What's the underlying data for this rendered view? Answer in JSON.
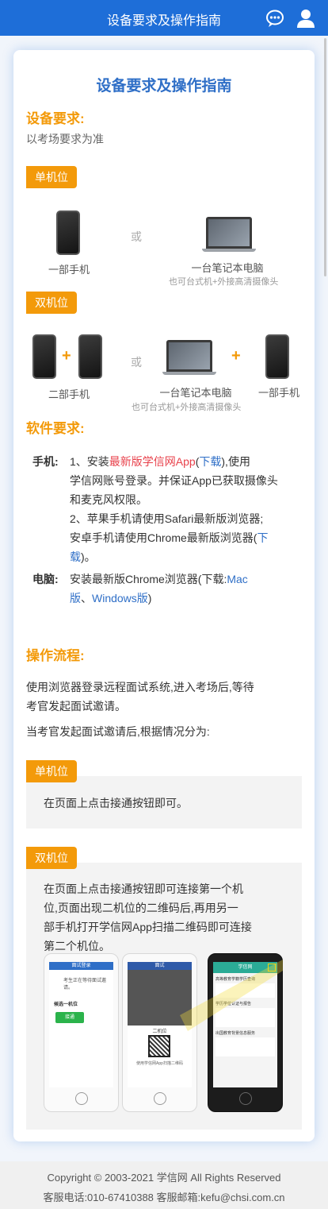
{
  "header": {
    "title": "设备要求及操作指南",
    "chat_icon": "chat-bubble-icon",
    "user_icon": "user-icon"
  },
  "card": {
    "title": "设备要求及操作指南",
    "device": {
      "heading": "设备要求:",
      "note": "以考场要求为准",
      "single": {
        "tag": "单机位",
        "phone_label": "一部手机",
        "or": "或",
        "laptop_label": "一台笔记本电脑",
        "laptop_sub": "也可台式机+外接高清摄像头"
      },
      "dual": {
        "tag": "双机位",
        "phones_label": "二部手机",
        "or": "或",
        "laptop_label": "一台笔记本电脑",
        "laptop_sub": "也可台式机+外接高清摄像头",
        "phone_label": "一部手机",
        "plus": "+"
      }
    },
    "software": {
      "heading": "软件要求:",
      "phone_key": "手机:",
      "phone_l1_a": "1、安装",
      "phone_l1_red": "最新版学信网App",
      "phone_l1_b": "(",
      "phone_l1_link": "下载",
      "phone_l1_c": "),使用",
      "phone_l2": "学信网账号登录。并保证App已获取摄像头",
      "phone_l3": "和麦克风权限。",
      "phone_l4": "2、苹果手机请使用Safari最新版浏览器;",
      "phone_l5_a": "安卓手机请使用Chrome最新版浏览器(",
      "phone_l5_link": "下",
      "phone_l6_link": "载",
      "phone_l6_b": ")。",
      "pc_key": "电脑:",
      "pc_l1_a": "安装最新版Chrome浏览器(下载:",
      "pc_l1_link": "Mac",
      "pc_l2_link_a": "版",
      "pc_l2_sep": "、",
      "pc_l2_link_b": "Windows版",
      "pc_l2_end": ")"
    },
    "process": {
      "heading": "操作流程:",
      "p1_l1": "使用浏览器登录远程面试系统,进入考场后,等待",
      "p1_l2": "考官发起面试邀请。",
      "p2": "当考官发起面试邀请后,根据情况分为:",
      "single_tag": "单机位",
      "single_text": "在页面上点击接通按钮即可。",
      "dual_tag": "双机位",
      "dual_l1": "在页面上点击接通按钮即可连接第一个机",
      "dual_l2": "位,页面出现二机位的二维码后,再用另一",
      "dual_l3": "部手机打开学信网App扫描二维码即可连接",
      "dual_l4": "第二个机位。",
      "mock1_title": "面试登录",
      "mock1_line": "考生正在等待面试邀请。",
      "mock1_label": "候选一机位",
      "mock1_btn": "接通",
      "mock2_title": "面试",
      "mock2_qr": "二机位",
      "mock2_caption": "使用学信网App扫描二维码",
      "mock3_title": "学信网",
      "mock3_row1": "高等教育学籍学历查询",
      "mock3_row2": "学历学位认证与报告",
      "mock3_row3": "出国教育背景信息服务"
    }
  },
  "footer": {
    "copyright": "Copyright © 2003-2021 学信网 All Rights Reserved",
    "contact": "客服电话:010-67410388   客服邮箱:kefu@chsi.com.cn"
  },
  "colors": {
    "primary": "#1e6ed8",
    "accent": "#f39a0a",
    "title_blue": "#2f6fc7",
    "red": "#e8414b"
  }
}
